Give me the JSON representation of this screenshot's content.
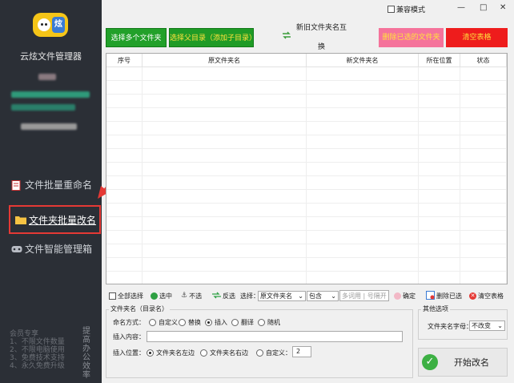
{
  "app": {
    "name": "云炫文件管理器"
  },
  "sidebar": {
    "items": [
      {
        "label": "文件批量重命名"
      },
      {
        "label": "文件夹批量改名"
      },
      {
        "label": "文件智能管理箱"
      }
    ],
    "promo_lines": [
      "会员专享",
      "1、不限文件数量",
      "2、不限电脑使用",
      "3、免费技术支持",
      "4、永久免费升级"
    ],
    "promo_vertical": "提高办公效率"
  },
  "titlebar": {
    "compat_label": "兼容模式",
    "min": "—",
    "max": "□",
    "close": "✕"
  },
  "toolbar": {
    "add_files": "选择多个文件夹",
    "add_parent": "选择父目录（添加子目录）",
    "swap": "新旧文件夹名互换",
    "delete_selected": "删除已选的文件夹",
    "clear_table": "清空表格"
  },
  "table": {
    "headers": [
      "序号",
      "原文件夹名",
      "新文件夹名",
      "所在位置",
      "状态"
    ]
  },
  "filter": {
    "select_all": "全部选择",
    "select": "选中",
    "deselect": "不选",
    "invert": "反选",
    "choose_label": "选择：",
    "field_value": "原文件夹名",
    "match_value": "包含",
    "input_placeholder": "多词用 | 号隔开",
    "confirm": "确定",
    "delete_selected": "删除已选",
    "clear_table": "清空表格"
  },
  "naming": {
    "group_title": "文件夹名（目录名）",
    "mode_label": "命名方式：",
    "modes": [
      "自定义",
      "替换",
      "插入",
      "翻译",
      "随机"
    ],
    "mode_selected": "插入",
    "insert_label": "插入内容：",
    "insert_value": "",
    "position_label": "插入位置：",
    "positions": [
      "文件夹名左边",
      "文件夹名右边",
      "自定义："
    ],
    "position_selected": "文件夹名左边",
    "custom_value": "2"
  },
  "other": {
    "group_title": "其他选项",
    "case_label": "文件夹名字母：",
    "case_value": "不改变"
  },
  "start_button": "开始改名",
  "colors": {
    "sidebar_bg": "#2b2f36",
    "green_button": "#22a02a",
    "pink_button": "#f5739b",
    "red_button": "#ee1c1c",
    "highlight": "#e53935"
  }
}
